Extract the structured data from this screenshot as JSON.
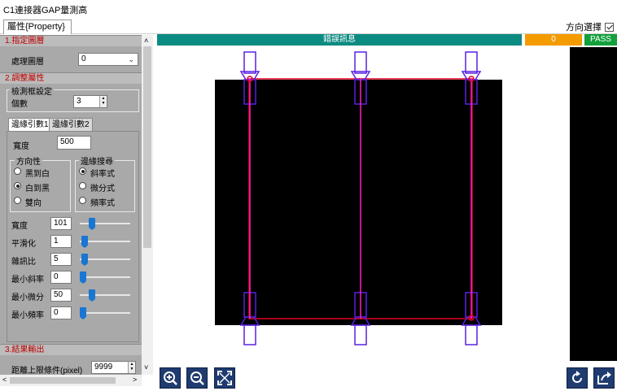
{
  "window": {
    "title": "C1連接器GAP量測高"
  },
  "tabs": [
    {
      "label": "屬性{Property}"
    }
  ],
  "direction_select": {
    "label": "方向選擇",
    "checked": true
  },
  "sections": {
    "specify_layer": {
      "title": "1.指定圖層",
      "layer_label": "處理圖層",
      "layer_value": "0"
    },
    "adjust_attr": {
      "title": "2.調整屬性",
      "detect_frame_group": "檢測框設定",
      "count_label": "個數",
      "count_value": "3",
      "edge_tabs": [
        "邊緣引數1",
        "邊緣引數2"
      ],
      "width_label": "寬度",
      "width_value": "500",
      "direction_group": "方向性",
      "direction_options": [
        "黑到白",
        "白到黑",
        "雙向"
      ],
      "direction_selected": "白到黑",
      "edge_search_group": "邊緣搜尋",
      "edge_search_options": [
        "斜率式",
        "微分式",
        "頻率式"
      ],
      "edge_search_selected": "斜率式",
      "sliders": [
        {
          "label": "寬度",
          "value": "101",
          "level": 0.2
        },
        {
          "label": "平滑化",
          "value": "1",
          "level": 0.03
        },
        {
          "label": "雜訊比",
          "value": "5",
          "level": 0.03
        },
        {
          "label": "最小斜率",
          "value": "0",
          "level": 0.0
        },
        {
          "label": "最小微分",
          "value": "50",
          "level": 0.2
        },
        {
          "label": "最小頻率",
          "value": "0",
          "level": 0.0
        }
      ]
    },
    "result_output": {
      "title": "3.結果輸出",
      "distance_label": "距離上限條件(pixel)",
      "distance_value": "9999"
    }
  },
  "status": {
    "text": "錯誤訊息",
    "count": "0",
    "result": "PASS"
  },
  "colors": {
    "status_teal": "#0b8b81",
    "count_orange": "#f49b00",
    "pass_green": "#12a03c",
    "tool_blue": "#1f3b70"
  },
  "toolbar": {
    "left": [
      "zoom-in-icon",
      "zoom-out-icon",
      "fit-screen-icon"
    ],
    "right": [
      "refresh-icon",
      "export-icon"
    ]
  }
}
